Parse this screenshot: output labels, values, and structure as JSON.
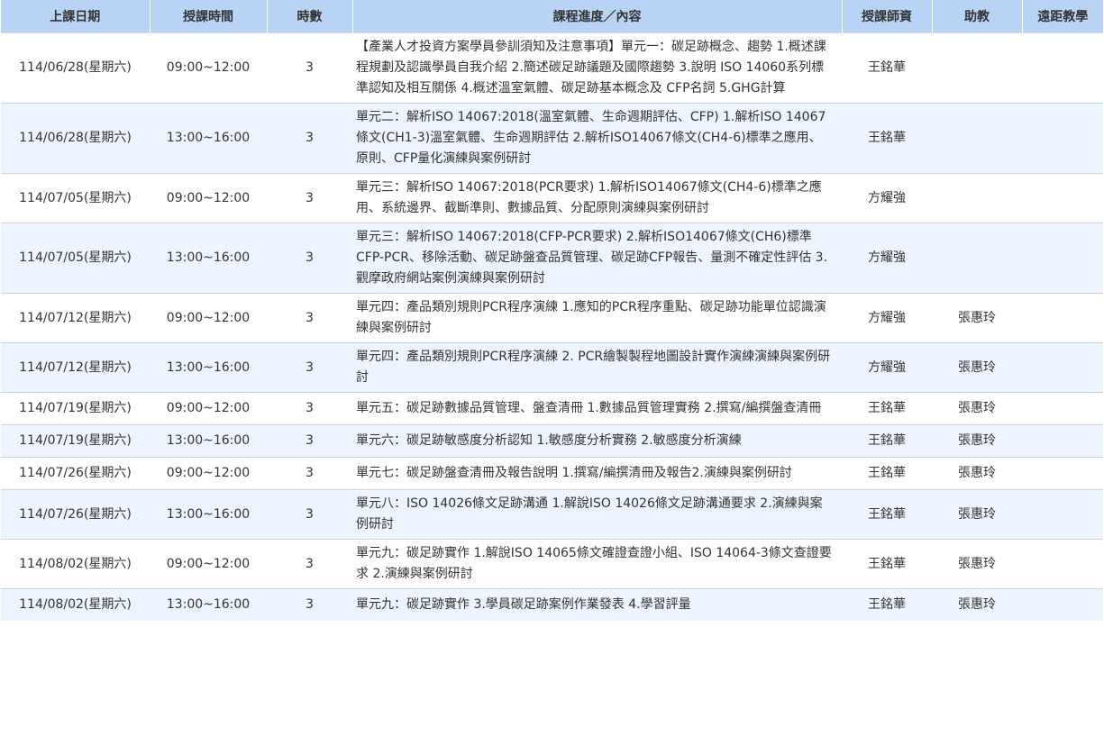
{
  "headers": {
    "date": "上課日期",
    "time": "授課時間",
    "hours": "時數",
    "content": "課程進度／內容",
    "teacher": "授課師資",
    "assistant": "助教",
    "remote": "遠距教學"
  },
  "rows": [
    {
      "date": "114/06/28(星期六)",
      "time": "09:00~12:00",
      "hours": "3",
      "content": "【產業人才投資方案學員參訓須知及注意事項】單元一：碳足跡概念、趨勢 1.概述課程規劃及認識學員自我介紹 2.簡述碳足跡議題及國際趨勢 3.說明 ISO 14060系列標準認知及相互關係 4.概述溫室氣體、碳足跡基本概念及 CFP名詞 5.GHG計算",
      "teacher": "王銘華",
      "assistant": "",
      "remote": ""
    },
    {
      "date": "114/06/28(星期六)",
      "time": "13:00~16:00",
      "hours": "3",
      "content": "單元二：解析ISO 14067:2018(溫室氣體、生命週期評估、CFP) 1.解析ISO 14067條文(CH1-3)溫室氣體、生命週期評估 2.解析ISO14067條文(CH4-6)標準之應用、原則、CFP量化演練與案例研討",
      "teacher": "王銘華",
      "assistant": "",
      "remote": ""
    },
    {
      "date": "114/07/05(星期六)",
      "time": "09:00~12:00",
      "hours": "3",
      "content": "單元三：解析ISO 14067:2018(PCR要求) 1.解析ISO14067條文(CH4-6)標準之應用、系統邊界、截斷準則、數據品質、分配原則演練與案例研討",
      "teacher": "方耀強",
      "assistant": "",
      "remote": ""
    },
    {
      "date": "114/07/05(星期六)",
      "time": "13:00~16:00",
      "hours": "3",
      "content": "單元三：解析ISO 14067:2018(CFP-PCR要求) 2.解析ISO14067條文(CH6)標準CFP-PCR、移除活動、碳足跡盤查品質管理、碳足跡CFP報告、量測不確定性評估 3.觀摩政府網站案例演練與案例研討",
      "teacher": "方耀強",
      "assistant": "",
      "remote": ""
    },
    {
      "date": "114/07/12(星期六)",
      "time": "09:00~12:00",
      "hours": "3",
      "content": "單元四：產品類別規則PCR程序演練 1.應知的PCR程序重點、碳足跡功能單位認識演練與案例研討",
      "teacher": "方耀強",
      "assistant": "張惠玲",
      "remote": ""
    },
    {
      "date": "114/07/12(星期六)",
      "time": "13:00~16:00",
      "hours": "3",
      "content": "單元四：產品類別規則PCR程序演練 2. PCR繪製製程地圖設計實作演練演練與案例研討",
      "teacher": "方耀強",
      "assistant": "張惠玲",
      "remote": ""
    },
    {
      "date": "114/07/19(星期六)",
      "time": "09:00~12:00",
      "hours": "3",
      "content": "單元五：碳足跡數據品質管理、盤查清冊 1.數據品質管理實務 2.撰寫/編撰盤查清冊",
      "teacher": "王銘華",
      "assistant": "張惠玲",
      "remote": ""
    },
    {
      "date": "114/07/19(星期六)",
      "time": "13:00~16:00",
      "hours": "3",
      "content": "單元六：碳足跡敏感度分析認知 1.敏感度分析實務 2.敏感度分析演練",
      "teacher": "王銘華",
      "assistant": "張惠玲",
      "remote": ""
    },
    {
      "date": "114/07/26(星期六)",
      "time": "09:00~12:00",
      "hours": "3",
      "content": "單元七：碳足跡盤查清冊及報告說明 1.撰寫/編撰清冊及報告2.演練與案例研討",
      "teacher": "王銘華",
      "assistant": "張惠玲",
      "remote": ""
    },
    {
      "date": "114/07/26(星期六)",
      "time": "13:00~16:00",
      "hours": "3",
      "content": "單元八：ISO 14026條文足跡溝通 1.解說ISO 14026條文足跡溝通要求 2.演練與案例研討",
      "teacher": "王銘華",
      "assistant": "張惠玲",
      "remote": ""
    },
    {
      "date": "114/08/02(星期六)",
      "time": "09:00~12:00",
      "hours": "3",
      "content": "單元九：碳足跡實作 1.解說ISO 14065條文確證查證小組、ISO 14064-3條文查證要求 2.演練與案例研討",
      "teacher": "王銘華",
      "assistant": "張惠玲",
      "remote": ""
    },
    {
      "date": "114/08/02(星期六)",
      "time": "13:00~16:00",
      "hours": "3",
      "content": "單元九：碳足跡實作 3.學員碳足跡案例作業發表 4.學習評量",
      "teacher": "王銘華",
      "assistant": "張惠玲",
      "remote": ""
    }
  ]
}
